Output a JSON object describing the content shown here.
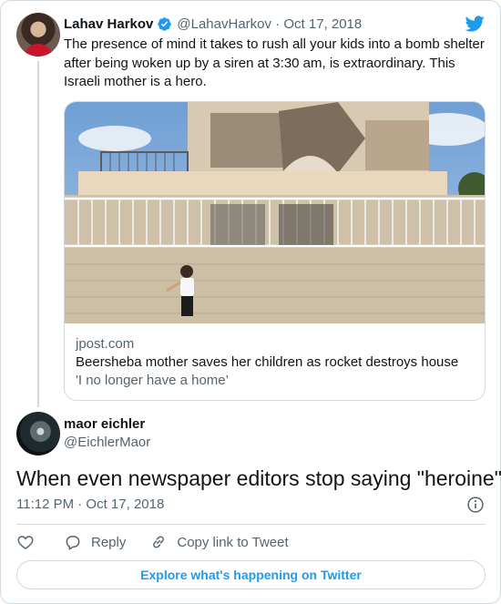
{
  "quoted_tweet": {
    "author_name": "Lahav Harkov",
    "author_handle": "@LahavHarkov",
    "date": "Oct 17, 2018",
    "meta_separator": " · ",
    "text": "The presence of mind it takes to rush all your kids into a bomb shelter after being woken up by a siren at 3:30 am, is extraordinary. This Israeli mother is a hero.",
    "link_card": {
      "domain": "jpost.com",
      "title": "Beersheba mother saves her children as rocket destroys house",
      "description": "'I no longer have a home’"
    }
  },
  "tweet": {
    "author_name": "maor eichler",
    "author_handle": "@EichlerMaor",
    "text": "When even newspaper editors stop saying \"heroine\"...",
    "timestamp": "11:12 PM · Oct 17, 2018"
  },
  "actions": {
    "reply_label": "Reply",
    "copy_label": "Copy link to Tweet"
  },
  "explore_label": "Explore what's happening on Twitter",
  "icons": {
    "brand": "twitter-bird-icon",
    "verified": "verified-badge-icon",
    "info": "info-icon",
    "like": "heart-icon",
    "reply": "reply-bubble-icon",
    "copy": "link-icon"
  },
  "colors": {
    "accent": "#1d9bf0",
    "text": "#0f1419",
    "secondary": "#536471",
    "border": "#cfd9de"
  }
}
